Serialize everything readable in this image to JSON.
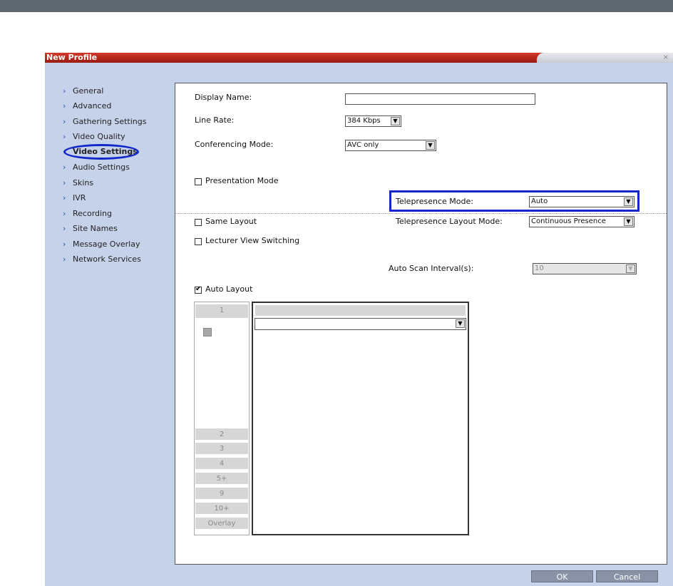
{
  "window": {
    "title": "New Profile",
    "close_glyph": "×"
  },
  "nav": {
    "items": [
      {
        "label": "General",
        "icon": "chevron-right-icon"
      },
      {
        "label": "Advanced",
        "icon": "chevron-right-icon"
      },
      {
        "label": "Gathering Settings",
        "icon": "chevron-right-icon"
      },
      {
        "label": "Video Quality",
        "icon": "chevron-right-icon"
      },
      {
        "label": "Video Settings",
        "icon": "chevron-right-icon",
        "active": true
      },
      {
        "label": "Audio Settings",
        "icon": "chevron-right-icon"
      },
      {
        "label": "Skins",
        "icon": "chevron-right-icon"
      },
      {
        "label": "IVR",
        "icon": "chevron-right-icon"
      },
      {
        "label": "Recording",
        "icon": "chevron-right-icon"
      },
      {
        "label": "Site Names",
        "icon": "chevron-right-icon"
      },
      {
        "label": "Message Overlay",
        "icon": "chevron-right-icon"
      },
      {
        "label": "Network Services",
        "icon": "chevron-right-icon"
      }
    ],
    "chevron_glyph": "›"
  },
  "form": {
    "display_name_label": "Display Name:",
    "display_name_value": "",
    "line_rate_label": "Line Rate:",
    "line_rate_value": "384 Kbps",
    "conferencing_mode_label": "Conferencing Mode:",
    "conferencing_mode_value": "AVC only",
    "presentation_mode_label": "Presentation Mode",
    "presentation_mode_checked": false,
    "telepresence_mode_label": "Telepresence Mode:",
    "telepresence_mode_value": "Auto",
    "same_layout_label": "Same Layout",
    "same_layout_checked": false,
    "telepresence_layout_mode_label": "Telepresence Layout Mode:",
    "telepresence_layout_mode_value": "Continuous Presence",
    "lecturer_view_switching_label": "Lecturer View Switching",
    "lecturer_view_switching_checked": false,
    "auto_scan_interval_label": "Auto Scan Interval(s):",
    "auto_scan_interval_value": "10",
    "auto_layout_label": "Auto Layout",
    "auto_layout_checked": true,
    "check_glyph": "✔",
    "dropdown_glyph": "▼"
  },
  "layout_tabs": [
    "1",
    "2",
    "3",
    "4",
    "5+",
    "9",
    "10+",
    "Overlay"
  ],
  "layout_dropdown_value": "",
  "buttons": {
    "ok": "OK",
    "cancel": "Cancel"
  },
  "colors": {
    "title_bar": "#c0281c",
    "dialog_bg": "#c6d2ea",
    "highlight": "#1427c8",
    "button": "#8a93a6"
  }
}
